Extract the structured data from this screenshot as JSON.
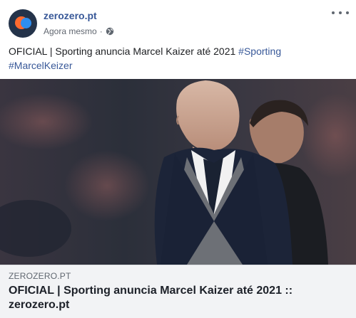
{
  "header": {
    "page_name": "zerozero.pt",
    "timestamp": "Agora mesmo",
    "separator": "·",
    "privacy_icon": "globe-icon",
    "menu_icon": "more-options-icon"
  },
  "post": {
    "text": "OFICIAL | Sporting anuncia Marcel Kaizer até 2021",
    "hashtags": [
      "#Sporting",
      "#MarcelKeizer"
    ]
  },
  "image": {
    "description_icon": "photo"
  },
  "link_preview": {
    "domain": "ZEROZERO.PT",
    "title": "OFICIAL | Sporting anuncia Marcel Kaizer até 2021 :: zerozero.pt"
  },
  "colors": {
    "link_blue": "#385898",
    "link_box_bg": "#f2f3f5",
    "avatar_bg": "#24334a",
    "avatar_orange": "#ff6a2f",
    "avatar_blue": "#2e8ef0"
  }
}
